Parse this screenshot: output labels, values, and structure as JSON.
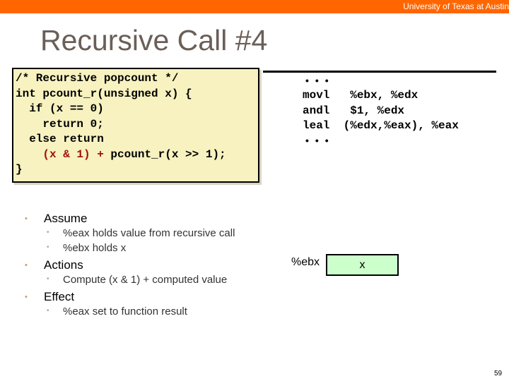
{
  "header": {
    "institution": "University of Texas at Austin",
    "bar_color": "#ff6600"
  },
  "slide": {
    "title": "Recursive Call #4",
    "page_number": "59"
  },
  "code": {
    "lines": [
      "/* Recursive popcount */",
      "int pcount_r(unsigned x) {",
      "  if (x == 0)",
      "    return 0;",
      "  else return",
      "}"
    ],
    "last_expr_highlight": "    (x & 1) +",
    "last_expr_rest": " pcount_r(x >> 1);",
    "highlight_color": "#a01010",
    "background": "#f7f2c0"
  },
  "assembly": {
    "ellipsis": "•••",
    "lines": [
      "movl   %ebx, %edx",
      "andl   $1, %edx",
      "leal  (%edx,%eax), %eax"
    ]
  },
  "bullets": [
    {
      "label": "Assume",
      "sub": [
        "%eax holds value from recursive call",
        "%ebx holds x"
      ]
    },
    {
      "label": "Actions",
      "sub": [
        "Compute (x & 1) + computed value"
      ]
    },
    {
      "label": "Effect",
      "sub": [
        "%eax set to function result"
      ]
    }
  ],
  "register": {
    "name": "%ebx",
    "value": "x",
    "color": "#ccffcc"
  }
}
